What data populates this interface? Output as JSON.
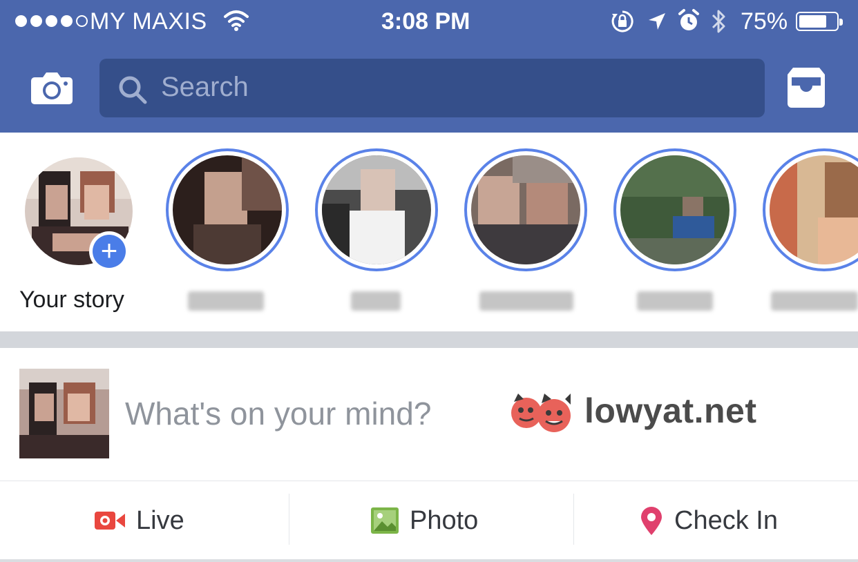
{
  "status_bar": {
    "carrier": "MY MAXIS",
    "time": "3:08 PM",
    "battery_percent": "75%",
    "battery_level": 0.75,
    "signal_strength": 4,
    "icons": [
      "wifi-icon",
      "orientation-lock-icon",
      "location-arrow-icon",
      "alarm-icon",
      "bluetooth-icon",
      "battery-icon"
    ]
  },
  "nav": {
    "search_placeholder": "Search",
    "left_icon": "camera-icon",
    "right_icon": "inbox-icon"
  },
  "stories": {
    "your_story_label": "Your story",
    "add_icon": "plus-icon",
    "ring_color": "#5a82e8"
  },
  "composer": {
    "placeholder": "What's on your mind?",
    "watermark": "lowyat.net"
  },
  "actions": [
    {
      "label": "Live",
      "icon": "live-video-icon",
      "color": "#e9473f"
    },
    {
      "label": "Photo",
      "icon": "photo-icon",
      "color": "#7cb548"
    },
    {
      "label": "Check In",
      "icon": "location-pin-icon",
      "color": "#e0406d"
    }
  ],
  "colors": {
    "brand_blue": "#4b67ad",
    "search_bg": "#354f8a"
  }
}
